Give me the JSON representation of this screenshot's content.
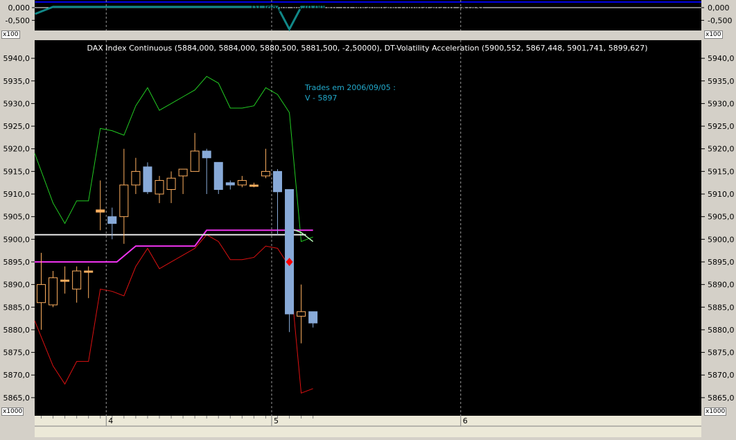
{
  "top_panel": {
    "title": "DT-Trigger VA (0,0000), DT-Volatilidade comparada (0,28143)",
    "ticks": [
      "0,000",
      "-0,500"
    ],
    "multiplier_left": "x100",
    "multiplier_right": "x100"
  },
  "main_panel": {
    "title": "DAX Index Continuous (5884,000, 5884,000, 5880,500, 5881,500, -2,50000), DT-Volatility Acceleration (5900,552, 5867,448, 5901,741, 5899,627)",
    "annotation_lines": [
      "Trades em 2006/09/05 :",
      "V - 5897"
    ],
    "multiplier_left": "x1000",
    "multiplier_right": "x1000"
  },
  "x_axis": {
    "labels": [
      "4",
      "5",
      "6"
    ]
  },
  "colors": {
    "background": "#000000",
    "up_candle": "#ffb060",
    "down_candle": "#88aad8",
    "upper_band": "#22cc22",
    "lower_band": "#dd1111",
    "magenta_line": "#ee33ee",
    "white_line": "#e8e8e8",
    "annotation": "#22aacc",
    "trigger_line": "#0000ee",
    "volatility_line": "#118888",
    "marker": "#ff0000"
  },
  "chart_data": [
    {
      "type": "line",
      "title": "DT-Trigger VA (0,0000), DT-Volatilidade comparada (0,28143)",
      "ylim": [
        -0.9,
        0.3
      ],
      "y_ticks": [
        0.0,
        -0.5
      ],
      "series": [
        {
          "name": "DT-Trigger VA",
          "x": [
            0,
            24
          ],
          "values": [
            0.22,
            0.22
          ]
        },
        {
          "name": "DT-Volatilidade comparada",
          "x": [
            0,
            1,
            2,
            3,
            4,
            5,
            6,
            7,
            8,
            9,
            10,
            11,
            12,
            13,
            14,
            15,
            16,
            17,
            18,
            19,
            20,
            21,
            22,
            23,
            24
          ],
          "values": [
            -0.25,
            0.03,
            0.03,
            0.03,
            0.03,
            0.03,
            0.03,
            0.03,
            0.03,
            0.03,
            0.03,
            0.03,
            0.03,
            0.03,
            0.03,
            0.03,
            0.03,
            0.03,
            0.03,
            0.03,
            0.03,
            -0.85,
            0.03,
            0.03,
            0.03
          ]
        }
      ]
    },
    {
      "type": "candlestick",
      "title": "DAX Index Continuous (5884,000, 5884,000, 5880,500, 5881,500, -2,50000), DT-Volatility Acceleration (5900,552, 5867,448, 5901,741, 5899,627)",
      "ylim": [
        5861,
        5944
      ],
      "y_ticks": [
        5865,
        5870,
        5875,
        5880,
        5885,
        5890,
        5895,
        5900,
        5905,
        5910,
        5915,
        5920,
        5925,
        5930,
        5935,
        5940
      ],
      "x_labels": [
        {
          "label": "4",
          "bar": 5.5
        },
        {
          "label": "5",
          "bar": 19.5
        },
        {
          "label": "6",
          "bar": 35.5
        }
      ],
      "candles": [
        {
          "bar": 0,
          "o": 5886,
          "h": 5897,
          "l": 5880,
          "c": 5890
        },
        {
          "bar": 1,
          "o": 5885.5,
          "h": 5893,
          "l": 5885,
          "c": 5891.5
        },
        {
          "bar": 2,
          "o": 5891,
          "h": 5894,
          "l": 5888,
          "c": 5891
        },
        {
          "bar": 3,
          "o": 5889,
          "h": 5894,
          "l": 5886,
          "c": 5893
        },
        {
          "bar": 4,
          "o": 5893,
          "h": 5894,
          "l": 5887,
          "c": 5893
        },
        {
          "bar": 5,
          "o": 5906,
          "h": 5913,
          "l": 5902,
          "c": 5906.5
        },
        {
          "bar": 6,
          "o": 5905,
          "h": 5907,
          "l": 5900,
          "c": 5903.5
        },
        {
          "bar": 7,
          "o": 5905,
          "h": 5920,
          "l": 5899,
          "c": 5912
        },
        {
          "bar": 8,
          "o": 5912,
          "h": 5918,
          "l": 5910,
          "c": 5915
        },
        {
          "bar": 9,
          "o": 5916,
          "h": 5917,
          "l": 5910,
          "c": 5910.5
        },
        {
          "bar": 10,
          "o": 5910,
          "h": 5914,
          "l": 5908,
          "c": 5913
        },
        {
          "bar": 11,
          "o": 5911,
          "h": 5915,
          "l": 5908,
          "c": 5913.5
        },
        {
          "bar": 12,
          "o": 5914,
          "h": 5915.5,
          "l": 5910,
          "c": 5915.5
        },
        {
          "bar": 13,
          "o": 5915,
          "h": 5923.5,
          "l": 5915,
          "c": 5919.5
        },
        {
          "bar": 14,
          "o": 5919.5,
          "h": 5920,
          "l": 5910,
          "c": 5918
        },
        {
          "bar": 15,
          "o": 5917,
          "h": 5917,
          "l": 5910,
          "c": 5911
        },
        {
          "bar": 16,
          "o": 5912.5,
          "h": 5913,
          "l": 5911,
          "c": 5912
        },
        {
          "bar": 17,
          "o": 5912,
          "h": 5914,
          "l": 5911.5,
          "c": 5913
        },
        {
          "bar": 18,
          "o": 5912,
          "h": 5912.5,
          "l": 5911.5,
          "c": 5912
        },
        {
          "bar": 19,
          "o": 5914,
          "h": 5920,
          "l": 5913.5,
          "c": 5915
        },
        {
          "bar": 20,
          "o": 5915,
          "h": 5915.5,
          "l": 5901,
          "c": 5910.5
        },
        {
          "bar": 21,
          "o": 5911,
          "h": 5911,
          "l": 5879.5,
          "c": 5883.5
        },
        {
          "bar": 22,
          "o": 5883,
          "h": 5890,
          "l": 5877,
          "c": 5884
        },
        {
          "bar": 23,
          "o": 5884,
          "h": 5884,
          "l": 5880.5,
          "c": 5881.5
        }
      ],
      "series": [
        {
          "name": "upper_band",
          "x": [
            0,
            1,
            2,
            3,
            4,
            5,
            6,
            7,
            8,
            9,
            10,
            11,
            12,
            13,
            14,
            15,
            16,
            17,
            18,
            19,
            20,
            21,
            22,
            23
          ],
          "values": [
            5919,
            5908,
            5903.5,
            5908.5,
            5908.5,
            5924.5,
            5924,
            5923,
            5929.5,
            5933.5,
            5928.5,
            5930,
            5931.5,
            5933,
            5936,
            5934.5,
            5929,
            5929,
            5929.5,
            5933.5,
            5932,
            5928,
            5899.5,
            5900.5
          ]
        },
        {
          "name": "lower_band",
          "x": [
            0,
            1,
            2,
            3,
            4,
            5,
            6,
            7,
            8,
            9,
            10,
            11,
            12,
            13,
            14,
            15,
            16,
            17,
            18,
            19,
            20,
            21,
            22,
            23
          ],
          "values": [
            5882,
            5872,
            5868,
            5873,
            5873,
            5889,
            5888.5,
            5887.5,
            5894,
            5898,
            5893.5,
            5895,
            5896.5,
            5898,
            5901,
            5899.5,
            5895.5,
            5895.5,
            5896,
            5898.5,
            5898,
            5894,
            5866,
            5867
          ]
        },
        {
          "name": "magenta_line",
          "x": [
            0,
            6.4,
            8,
            9,
            10,
            11,
            12,
            13,
            14,
            15,
            16,
            17,
            18,
            19,
            20,
            21,
            22,
            23
          ],
          "values": [
            5895,
            5895,
            5898.5,
            5898.5,
            5898.5,
            5898.5,
            5898.5,
            5898.5,
            5902,
            5902,
            5902,
            5902,
            5902,
            5902,
            5902,
            5902,
            5902,
            5902
          ]
        },
        {
          "name": "white_line",
          "x": [
            0,
            22.4
          ],
          "values": [
            5901,
            5901
          ]
        },
        {
          "name": "pale_green_line",
          "x": [
            20.6,
            21,
            22,
            23
          ],
          "values": [
            5901,
            5902.5,
            5901.5,
            5899.5
          ]
        }
      ],
      "markers": [
        {
          "bar": 21,
          "value": 5895,
          "shape": "diamond"
        }
      ]
    }
  ]
}
